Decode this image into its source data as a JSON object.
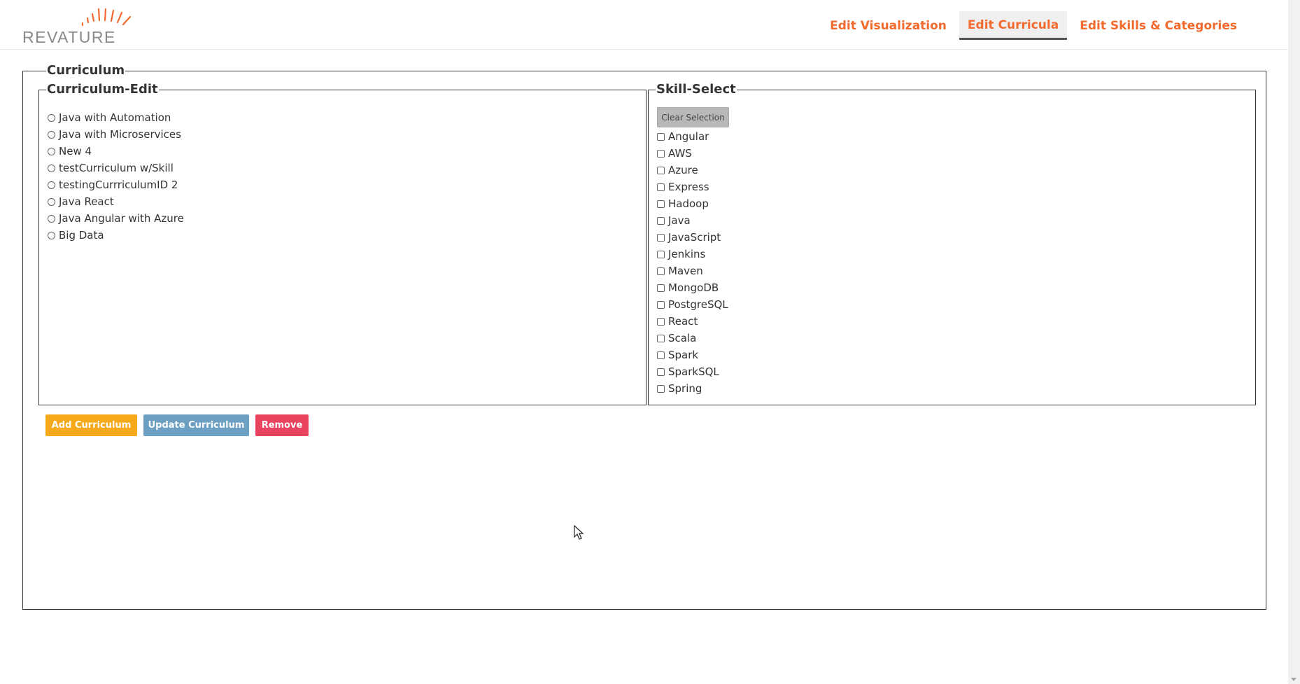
{
  "brand": {
    "name": "REVATURE",
    "accent": "#f26a2e"
  },
  "nav": {
    "items": [
      {
        "label": "Edit Visualization",
        "active": false
      },
      {
        "label": "Edit Curricula",
        "active": true
      },
      {
        "label": "Edit Skills & Categories",
        "active": false
      }
    ]
  },
  "curriculum": {
    "legend": "Curriculum",
    "edit": {
      "legend": "Curriculum-Edit",
      "options": [
        "Java with Automation",
        "Java with Microservices",
        "New 4",
        "testCurriculum w/Skill",
        "testingCurrriculumID 2",
        "Java React",
        "Java Angular with Azure",
        "Big Data"
      ]
    },
    "skills": {
      "legend": "Skill-Select",
      "clear_label": "Clear Selection",
      "options": [
        "Angular",
        "AWS",
        "Azure",
        "Express",
        "Hadoop",
        "Java",
        "JavaScript",
        "Jenkins",
        "Maven",
        "MongoDB",
        "PostgreSQL",
        "React",
        "Scala",
        "Spark",
        "SparkSQL",
        "Spring"
      ]
    },
    "actions": {
      "add_label": "Add Curriculum",
      "update_label": "Update Curriculum",
      "remove_label": "Remove"
    }
  }
}
